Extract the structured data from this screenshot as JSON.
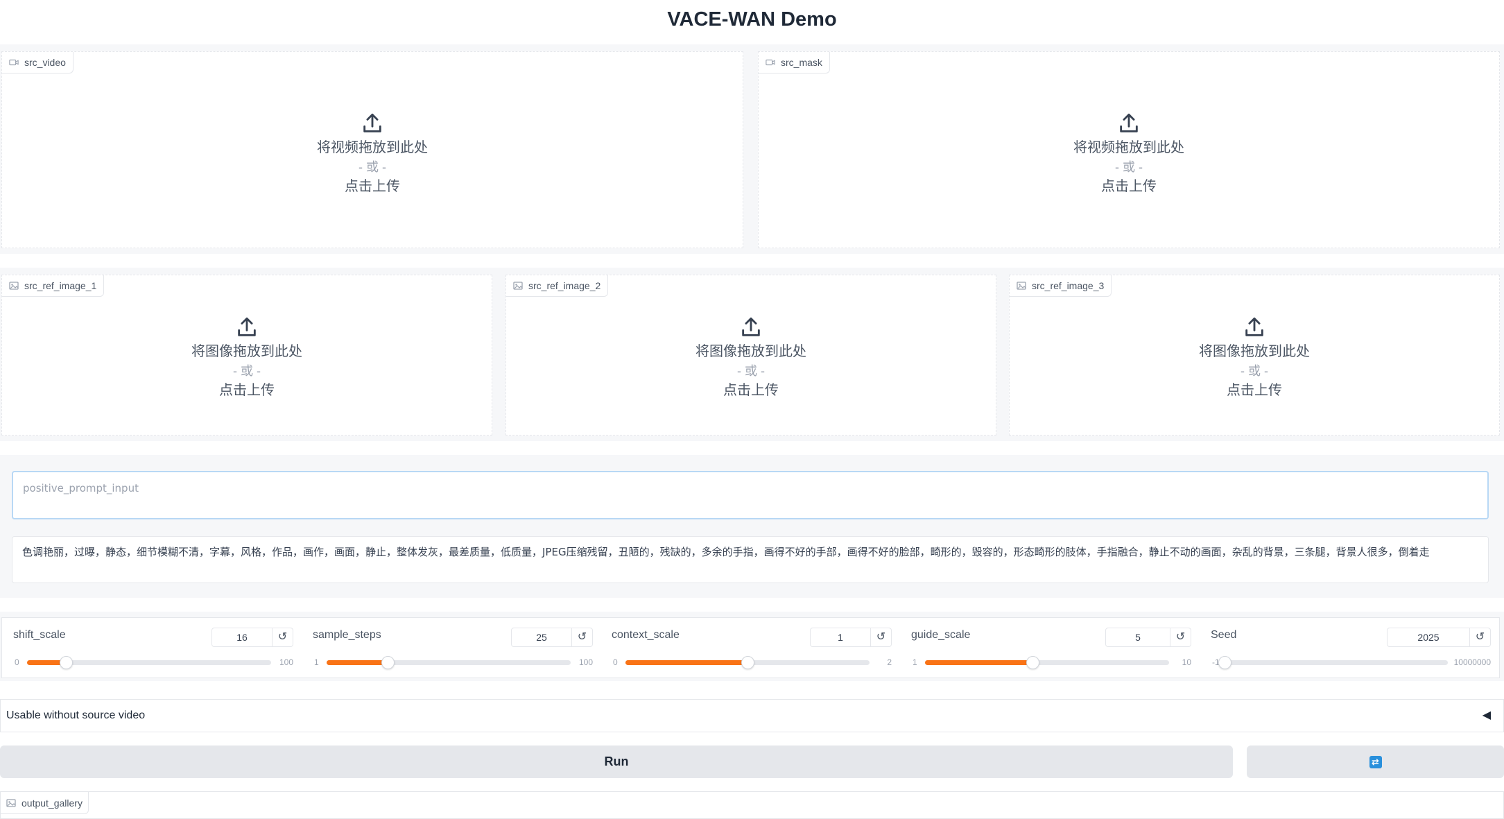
{
  "app": {
    "title": "VACE-WAN Demo"
  },
  "uploads": {
    "drop_video": "将视频拖放到此处",
    "drop_image": "将图像拖放到此处",
    "or": "- 或 -",
    "click": "点击上传",
    "src_video": "src_video",
    "src_mask": "src_mask",
    "ref1": "src_ref_image_1",
    "ref2": "src_ref_image_2",
    "ref3": "src_ref_image_3"
  },
  "prompts": {
    "positive_placeholder": "positive_prompt_input",
    "positive_value": "",
    "negative_value": "色调艳丽，过曝，静态，细节模糊不清，字幕，风格，作品，画作，画面，静止，整体发灰，最差质量，低质量，JPEG压缩残留，丑陋的，残缺的，多余的手指，画得不好的手部，画得不好的脸部，畸形的，毁容的，形态畸形的肢体，手指融合，静止不动的画面，杂乱的背景，三条腿，背景人很多，倒着走"
  },
  "sliders": [
    {
      "label": "shift_scale",
      "value": "16",
      "min": "0",
      "max": "100",
      "fraction": 0.16
    },
    {
      "label": "sample_steps",
      "value": "25",
      "min": "1",
      "max": "100",
      "fraction": 0.25
    },
    {
      "label": "context_scale",
      "value": "1",
      "min": "0",
      "max": "2",
      "fraction": 0.5
    },
    {
      "label": "guide_scale",
      "value": "5",
      "min": "1",
      "max": "10",
      "fraction": 0.44
    },
    {
      "label": "Seed",
      "value": "2025",
      "min": "-1",
      "max": "10000000",
      "fraction": 0.0002
    }
  ],
  "reset_glyph": "↺",
  "accordion": {
    "label": "Usable without source video",
    "arrow": "◀"
  },
  "buttons": {
    "run": "Run",
    "refresh_glyph": "⇄"
  },
  "output": {
    "label": "output_gallery"
  },
  "colors": {
    "accent": "#f97316",
    "refresh": "#2990dc",
    "focus_border": "#b8d8f5"
  }
}
